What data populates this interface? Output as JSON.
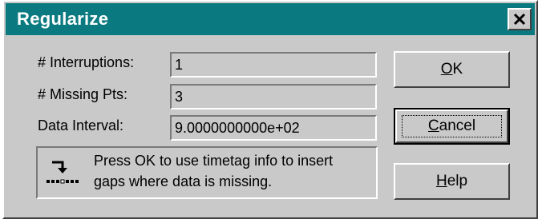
{
  "window": {
    "title": "Regularize"
  },
  "fields": [
    {
      "label": "# Interruptions:",
      "value": "1"
    },
    {
      "label": "# Missing Pts:",
      "value": "3"
    },
    {
      "label": "Data Interval:",
      "value": "9.0000000000e+02"
    }
  ],
  "buttons": {
    "ok": {
      "label_ul": "O",
      "label_rest": "K"
    },
    "cancel": {
      "label_ul": "C",
      "label_rest": "ancel"
    },
    "help": {
      "label_ul": "H",
      "label_rest": "elp"
    }
  },
  "info": {
    "line1": "Press OK to use timetag info to insert",
    "line2": "gaps where data is missing.",
    "icon": "insert-gaps-icon"
  },
  "colors": {
    "titlebar": "#0a7a80",
    "face": "#c9c9c9"
  }
}
